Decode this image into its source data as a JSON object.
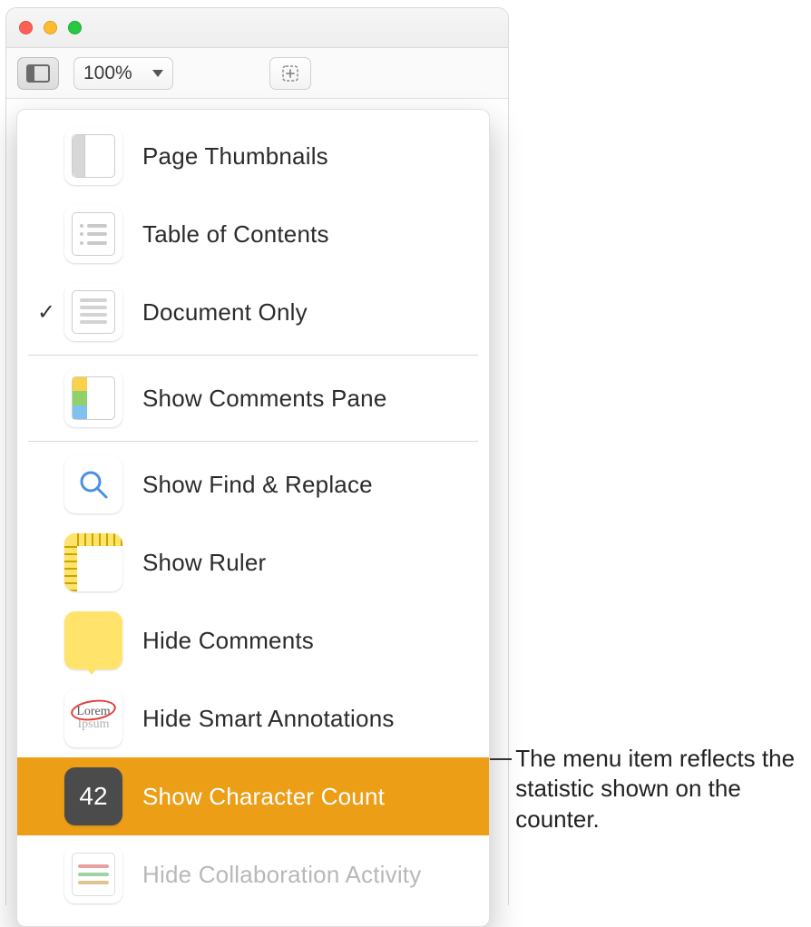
{
  "toolbar": {
    "zoom_value": "100%"
  },
  "menu": {
    "items": [
      {
        "label": "Page Thumbnails",
        "checked": false
      },
      {
        "label": "Table of Contents",
        "checked": false
      },
      {
        "label": "Document Only",
        "checked": true
      },
      {
        "label": "Show Comments Pane"
      },
      {
        "label": "Show Find & Replace"
      },
      {
        "label": "Show Ruler"
      },
      {
        "label": "Hide Comments"
      },
      {
        "label": "Hide Smart Annotations"
      },
      {
        "label": "Show Character Count",
        "highlighted": true,
        "count_badge": "42"
      },
      {
        "label": "Hide Collaboration Activity",
        "disabled": true
      }
    ]
  },
  "callout": {
    "text": "The menu item reflects the statistic shown on the counter."
  }
}
